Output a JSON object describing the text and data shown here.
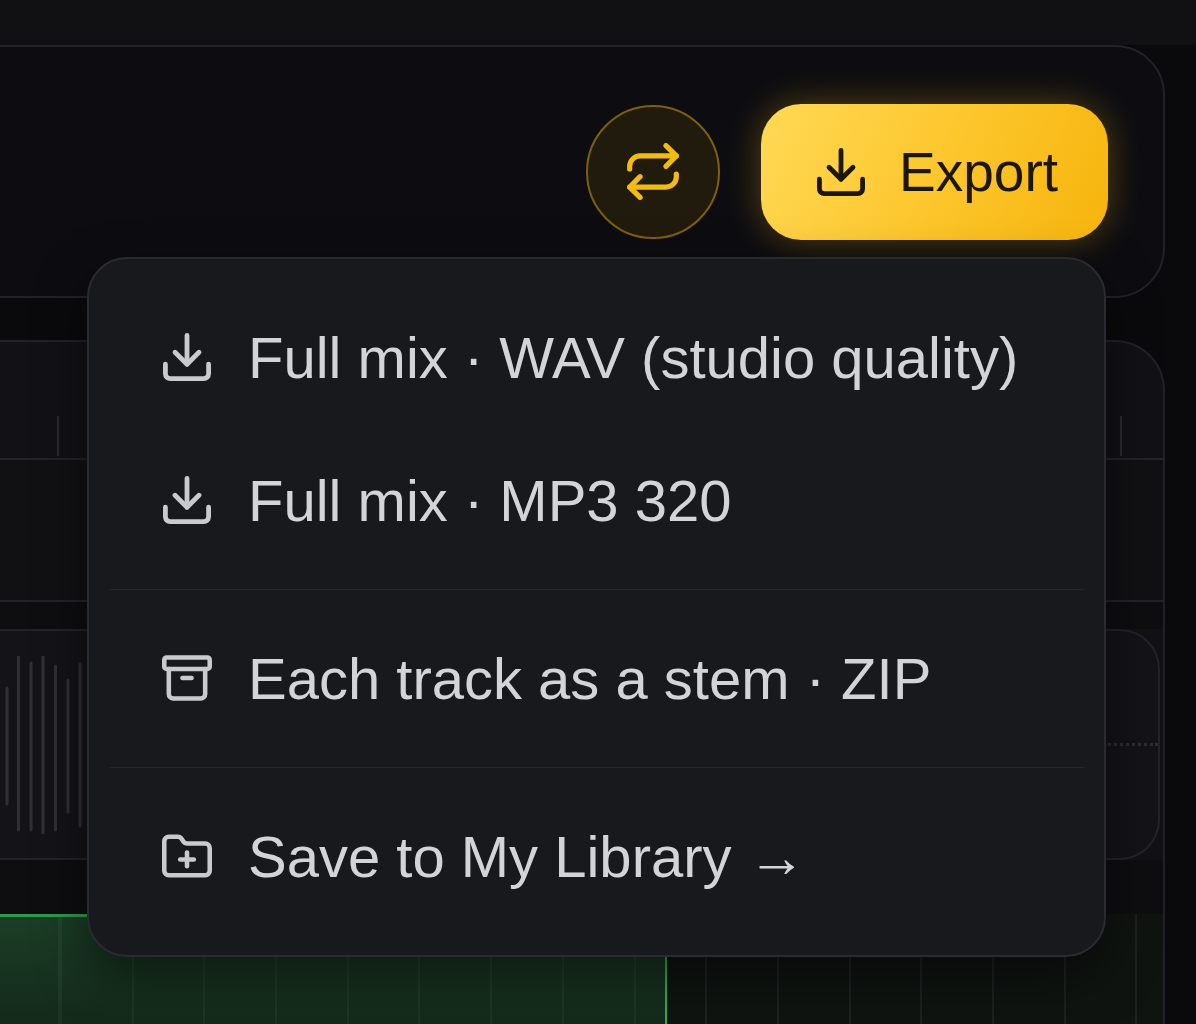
{
  "toolbar": {
    "repeat_button": {
      "active": true
    },
    "export_button": {
      "label": "Export",
      "expanded": true
    }
  },
  "export_menu": {
    "sections": [
      {
        "items": [
          {
            "kind": "download",
            "label": "Full mix · WAV (studio quality)"
          },
          {
            "kind": "download",
            "label": "Full mix · MP3 320"
          }
        ]
      },
      {
        "items": [
          {
            "kind": "archive",
            "label": "Each track as a stem · ZIP"
          }
        ]
      },
      {
        "items": [
          {
            "kind": "folder",
            "label": "Save to My Library →"
          }
        ]
      }
    ]
  }
}
